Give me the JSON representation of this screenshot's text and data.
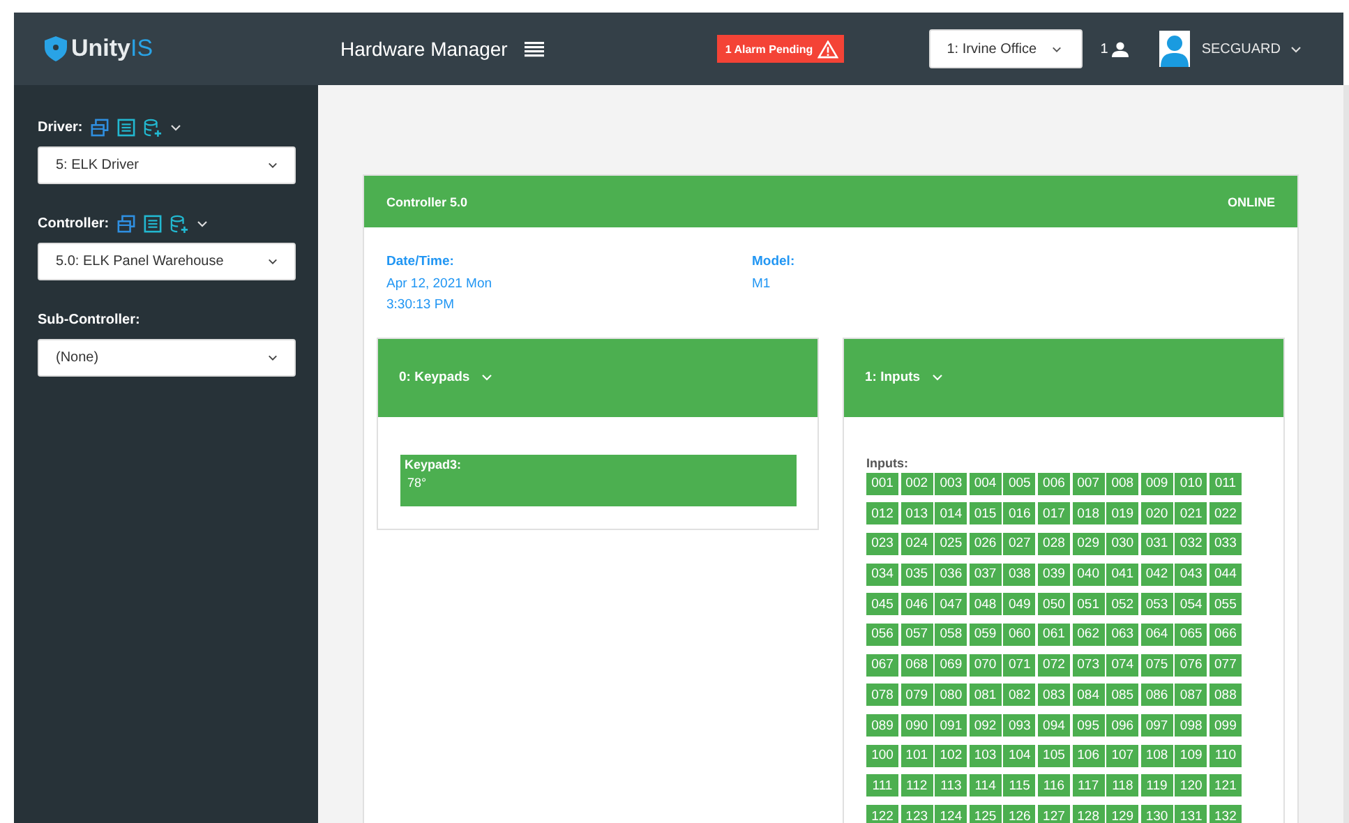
{
  "header": {
    "logo_text": "Unity",
    "logo_accent": "IS",
    "title": "Hardware Manager",
    "alarm": "1 Alarm Pending",
    "site": "1: Irvine Office",
    "user_count": "1",
    "user": "SECGUARD"
  },
  "sidebar": {
    "sections": [
      {
        "kind": "tools",
        "label": "Driver:",
        "value": "5: ELK Driver"
      },
      {
        "kind": "tools",
        "label": "Controller:",
        "value": "5.0: ELK Panel Warehouse"
      },
      {
        "kind": "plain",
        "label": "Sub-Controller:",
        "value": "(None)"
      }
    ]
  },
  "controller": {
    "title": "Controller 5.0",
    "status": "ONLINE",
    "fields": [
      {
        "label": "Date/Time:",
        "lines": [
          "Apr 12, 2021 Mon",
          "3:30:13 PM"
        ]
      },
      {
        "label": "Model:",
        "lines": [
          "M1"
        ]
      }
    ],
    "panels": [
      {
        "kind": "keypads",
        "title": "0: Keypads",
        "items": [
          {
            "name": "Keypad3:",
            "value": "78°"
          }
        ]
      },
      {
        "kind": "inputs",
        "title": "1: Inputs",
        "label": "Inputs:",
        "inputs": [
          "001",
          "002",
          "003",
          "004",
          "005",
          "006",
          "007",
          "008",
          "009",
          "010",
          "011",
          "012",
          "013",
          "014",
          "015",
          "016",
          "017",
          "018",
          "019",
          "020",
          "021",
          "022",
          "023",
          "024",
          "025",
          "026",
          "027",
          "028",
          "029",
          "030",
          "031",
          "032",
          "033",
          "034",
          "035",
          "036",
          "037",
          "038",
          "039",
          "040",
          "041",
          "042",
          "043",
          "044",
          "045",
          "046",
          "047",
          "048",
          "049",
          "050",
          "051",
          "052",
          "053",
          "054",
          "055",
          "056",
          "057",
          "058",
          "059",
          "060",
          "061",
          "062",
          "063",
          "064",
          "065",
          "066",
          "067",
          "068",
          "069",
          "070",
          "071",
          "072",
          "073",
          "074",
          "075",
          "076",
          "077",
          "078",
          "079",
          "080",
          "081",
          "082",
          "083",
          "084",
          "085",
          "086",
          "087",
          "088",
          "089",
          "090",
          "091",
          "092",
          "093",
          "094",
          "095",
          "096",
          "097",
          "098",
          "099",
          "100",
          "101",
          "102",
          "103",
          "104",
          "105",
          "106",
          "107",
          "108",
          "109",
          "110",
          "111",
          "112",
          "113",
          "114",
          "115",
          "116",
          "117",
          "118",
          "119",
          "120",
          "121",
          "122",
          "123",
          "124",
          "125",
          "126",
          "127",
          "128",
          "129",
          "130",
          "131",
          "132"
        ]
      }
    ]
  }
}
